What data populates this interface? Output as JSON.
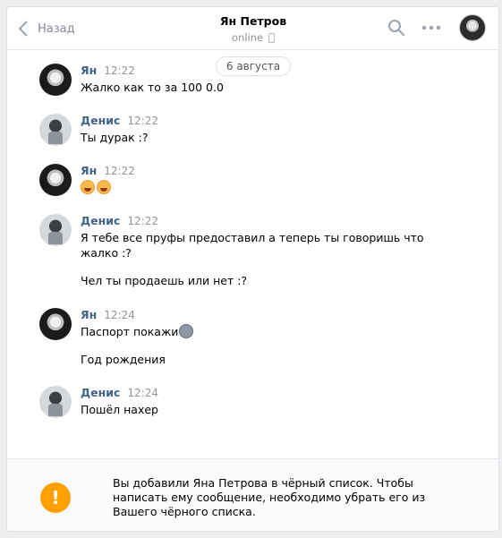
{
  "header": {
    "back_label": "Назад",
    "title": "Ян Петров",
    "status": "online"
  },
  "date_separator": "6 августа",
  "messages": [
    {
      "author": "Ян",
      "time": "12:22",
      "avatar": "avatar-yan",
      "lines": [
        "Жалко как то за 100 0.0"
      ]
    },
    {
      "author": "Денис",
      "time": "12:22",
      "avatar": "avatar-denis",
      "lines": [
        "Ты дурак :?"
      ]
    },
    {
      "author": "Ян",
      "time": "12:22",
      "avatar": "avatar-yan",
      "emoji": [
        "laughing-emoji",
        "laughing-emoji"
      ]
    },
    {
      "author": "Денис",
      "time": "12:22",
      "avatar": "avatar-denis",
      "lines": [
        "Я тебе все пруфы предоставил а теперь ты говоришь что",
        "жалко :?",
        "Чел ты продаешь или нет :?"
      ]
    },
    {
      "author": "Ян",
      "time": "12:24",
      "avatar": "avatar-yan",
      "lines": [
        "Паспорт покажи",
        "Год рождения"
      ],
      "emoji": [
        "gray-face-emoji"
      ]
    },
    {
      "author": "Денис",
      "time": "12:24",
      "avatar": "avatar-denis",
      "lines": [
        "Пошёл нахер"
      ]
    }
  ],
  "footer": {
    "icon": "warning-icon",
    "icon_glyph": "!",
    "text": "Вы добавили Яна Петрова в чёрный список. Чтобы написать ему сообщение, необходимо убрать его из Вашего чёрного списка."
  },
  "colors": {
    "author": "#42648b",
    "warning": "#ffa000",
    "background": "#edeef0"
  }
}
